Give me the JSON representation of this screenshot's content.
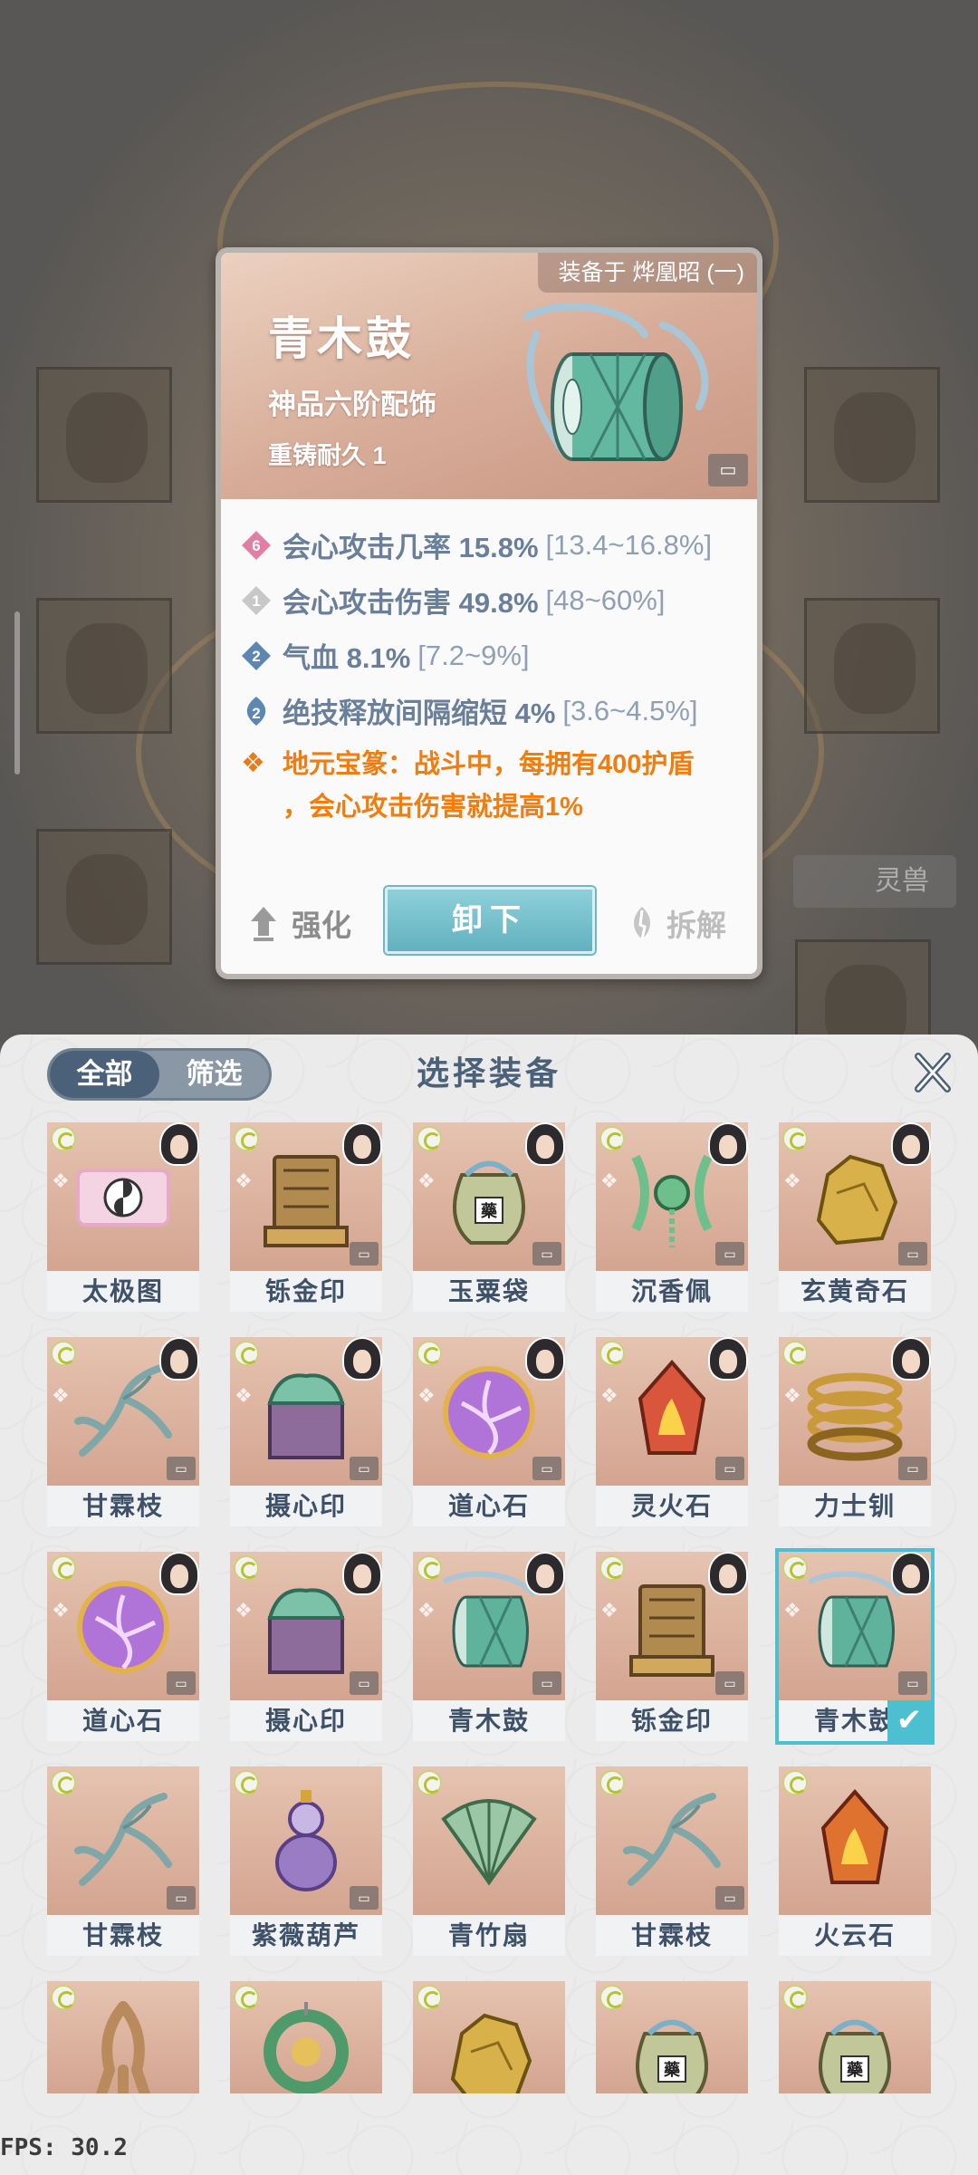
{
  "popup": {
    "equipped_on": "装备于 烨凰昭 (一)",
    "item_name": "青木鼓",
    "grade": "神品六阶配饰",
    "reforge": "重铸耐久 1",
    "stats": [
      {
        "badge": "6",
        "badge_color": "#e07fa3",
        "name": "会心攻击几率 15.8%",
        "range": "[13.4~16.8%]"
      },
      {
        "badge": "1",
        "badge_color": "#c8c8c8",
        "name": "会心攻击伤害 49.8%",
        "range": "[48~60%]"
      },
      {
        "badge": "2",
        "badge_color": "#5c87b3",
        "name": "气血 8.1%",
        "range": "[7.2~9%]"
      },
      {
        "badge": "2",
        "badge_color": "#5c87b3",
        "name": "绝技释放间隔缩短 4%",
        "range": "[3.6~4.5%]"
      }
    ],
    "set_bonus_line1": "地元宝篆：战斗中，每拥有400护盾",
    "set_bonus_line2": "，会心攻击伤害就提高1%",
    "actions": {
      "enhance": "强化",
      "unequip": "卸下",
      "dismantle": "拆解"
    }
  },
  "background": {
    "beast_label": "灵兽"
  },
  "panel": {
    "filter_all": "全部",
    "filter_screen": "筛选",
    "title": "选择装备"
  },
  "items": [
    {
      "name": "太极图",
      "art": "scroll",
      "color": "#e6a9c6"
    },
    {
      "name": "铄金印",
      "art": "seal",
      "color": "#b08a4e"
    },
    {
      "name": "玉粟袋",
      "art": "bag",
      "color": "#c2c79a"
    },
    {
      "name": "沉香佩",
      "art": "pendant",
      "color": "#6fbf8c"
    },
    {
      "name": "玄黄奇石",
      "art": "rock",
      "color": "#d9b14a"
    },
    {
      "name": "甘霖枝",
      "art": "branch",
      "color": "#7fa7a8"
    },
    {
      "name": "摄心印",
      "art": "box",
      "color": "#8d6b9a"
    },
    {
      "name": "道心石",
      "art": "orb",
      "color": "#b074d8"
    },
    {
      "name": "灵火石",
      "art": "crystal",
      "color": "#d9563c"
    },
    {
      "name": "力士钏",
      "art": "coil",
      "color": "#c99a3a"
    },
    {
      "name": "道心石",
      "art": "orb",
      "color": "#b074d8"
    },
    {
      "name": "摄心印",
      "art": "box",
      "color": "#8d6b9a"
    },
    {
      "name": "青木鼓",
      "art": "drum",
      "color": "#5fb39b"
    },
    {
      "name": "铄金印",
      "art": "seal",
      "color": "#b08a4e"
    },
    {
      "name": "青木鼓",
      "art": "drum",
      "color": "#5fb39b"
    },
    {
      "name": "甘霖枝",
      "art": "branch",
      "color": "#7fa7a8"
    },
    {
      "name": "紫薇葫芦",
      "art": "gourd",
      "color": "#9a7cc4"
    },
    {
      "name": "青竹扇",
      "art": "fan",
      "color": "#9cc7a6"
    },
    {
      "name": "甘霖枝",
      "art": "branch",
      "color": "#7fa7a8"
    },
    {
      "name": "火云石",
      "art": "crystal",
      "color": "#e0722f"
    },
    {
      "name": "",
      "art": "root",
      "color": "#b98a5c"
    },
    {
      "name": "",
      "art": "ring",
      "color": "#4f9a6a"
    },
    {
      "name": "",
      "art": "rock",
      "color": "#d9b14a"
    },
    {
      "name": "",
      "art": "bag",
      "color": "#c2c79a"
    },
    {
      "name": "",
      "art": "bag",
      "color": "#c2c79a"
    }
  ],
  "fps_label": "FPS: 30.2"
}
